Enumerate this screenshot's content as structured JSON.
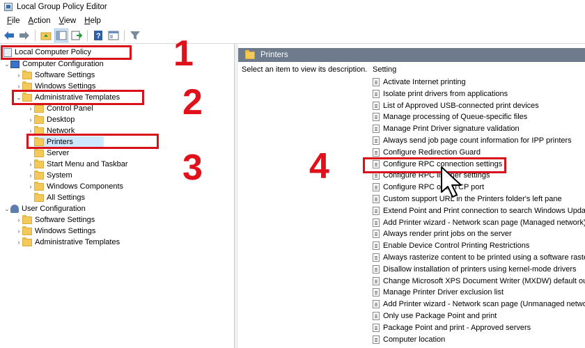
{
  "window": {
    "title": "Local Group Policy Editor",
    "icon": "group-policy-icon"
  },
  "menu": [
    {
      "label": "File",
      "key": "F",
      "rest": "ile"
    },
    {
      "label": "Action",
      "key": "A",
      "rest": "ction"
    },
    {
      "label": "View",
      "key": "V",
      "rest": "iew"
    },
    {
      "label": "Help",
      "key": "H",
      "rest": "elp"
    }
  ],
  "toolbar": {
    "icons": [
      "back-arrow-icon",
      "forward-arrow-icon",
      "up-folder-icon",
      "show-hide-tree-icon",
      "export-list-icon",
      "help-icon",
      "properties-icon",
      "filter-icon"
    ]
  },
  "tree": {
    "root": "Local Computer Policy",
    "computer_config": "Computer Configuration",
    "cc_software": "Software Settings",
    "cc_windows": "Windows Settings",
    "cc_admin": "Administrative Templates",
    "control_panel": "Control Panel",
    "desktop": "Desktop",
    "network": "Network",
    "printers": "Printers",
    "server": "Server",
    "start_menu": "Start Menu and Taskbar",
    "system": "System",
    "windows_components": "Windows Components",
    "all_settings": "All Settings",
    "user_config": "User Configuration",
    "uc_software": "Software Settings",
    "uc_windows": "Windows Settings",
    "uc_admin": "Administrative Templates"
  },
  "right": {
    "header": "Printers",
    "description": "Select an item to view its description.",
    "column": "Setting",
    "settings": [
      "Activate Internet printing",
      "Isolate print drivers from applications",
      "List of Approved USB-connected print devices",
      "Manage processing of Queue-specific files",
      "Manage Print Driver signature validation",
      "Always send job page count information for IPP printers",
      "Configure Redirection Guard",
      "Configure RPC connection settings",
      "Configure RPC listener settings",
      "Configure RPC over TCP port",
      "Custom support URL in the Printers folder's left pane",
      "Extend Point and Print connection to search Windows Update",
      "Add Printer wizard - Network scan page (Managed network)",
      "Always render print jobs on the server",
      "Enable Device Control Printing Restrictions",
      "Always rasterize content to be printed using a software rasterizer",
      "Disallow installation of printers using kernel-mode drivers",
      "Change Microsoft XPS Document Writer (MXDW) default output format",
      "Manage Printer Driver exclusion list",
      "Add Printer wizard - Network scan page (Unmanaged network)",
      "Only use Package Point and print",
      "Package Point and print - Approved servers",
      "Computer location"
    ]
  },
  "annotations": {
    "step1": "1",
    "step2": "2",
    "step3": "3",
    "step4": "4",
    "color": "#d8101a"
  }
}
